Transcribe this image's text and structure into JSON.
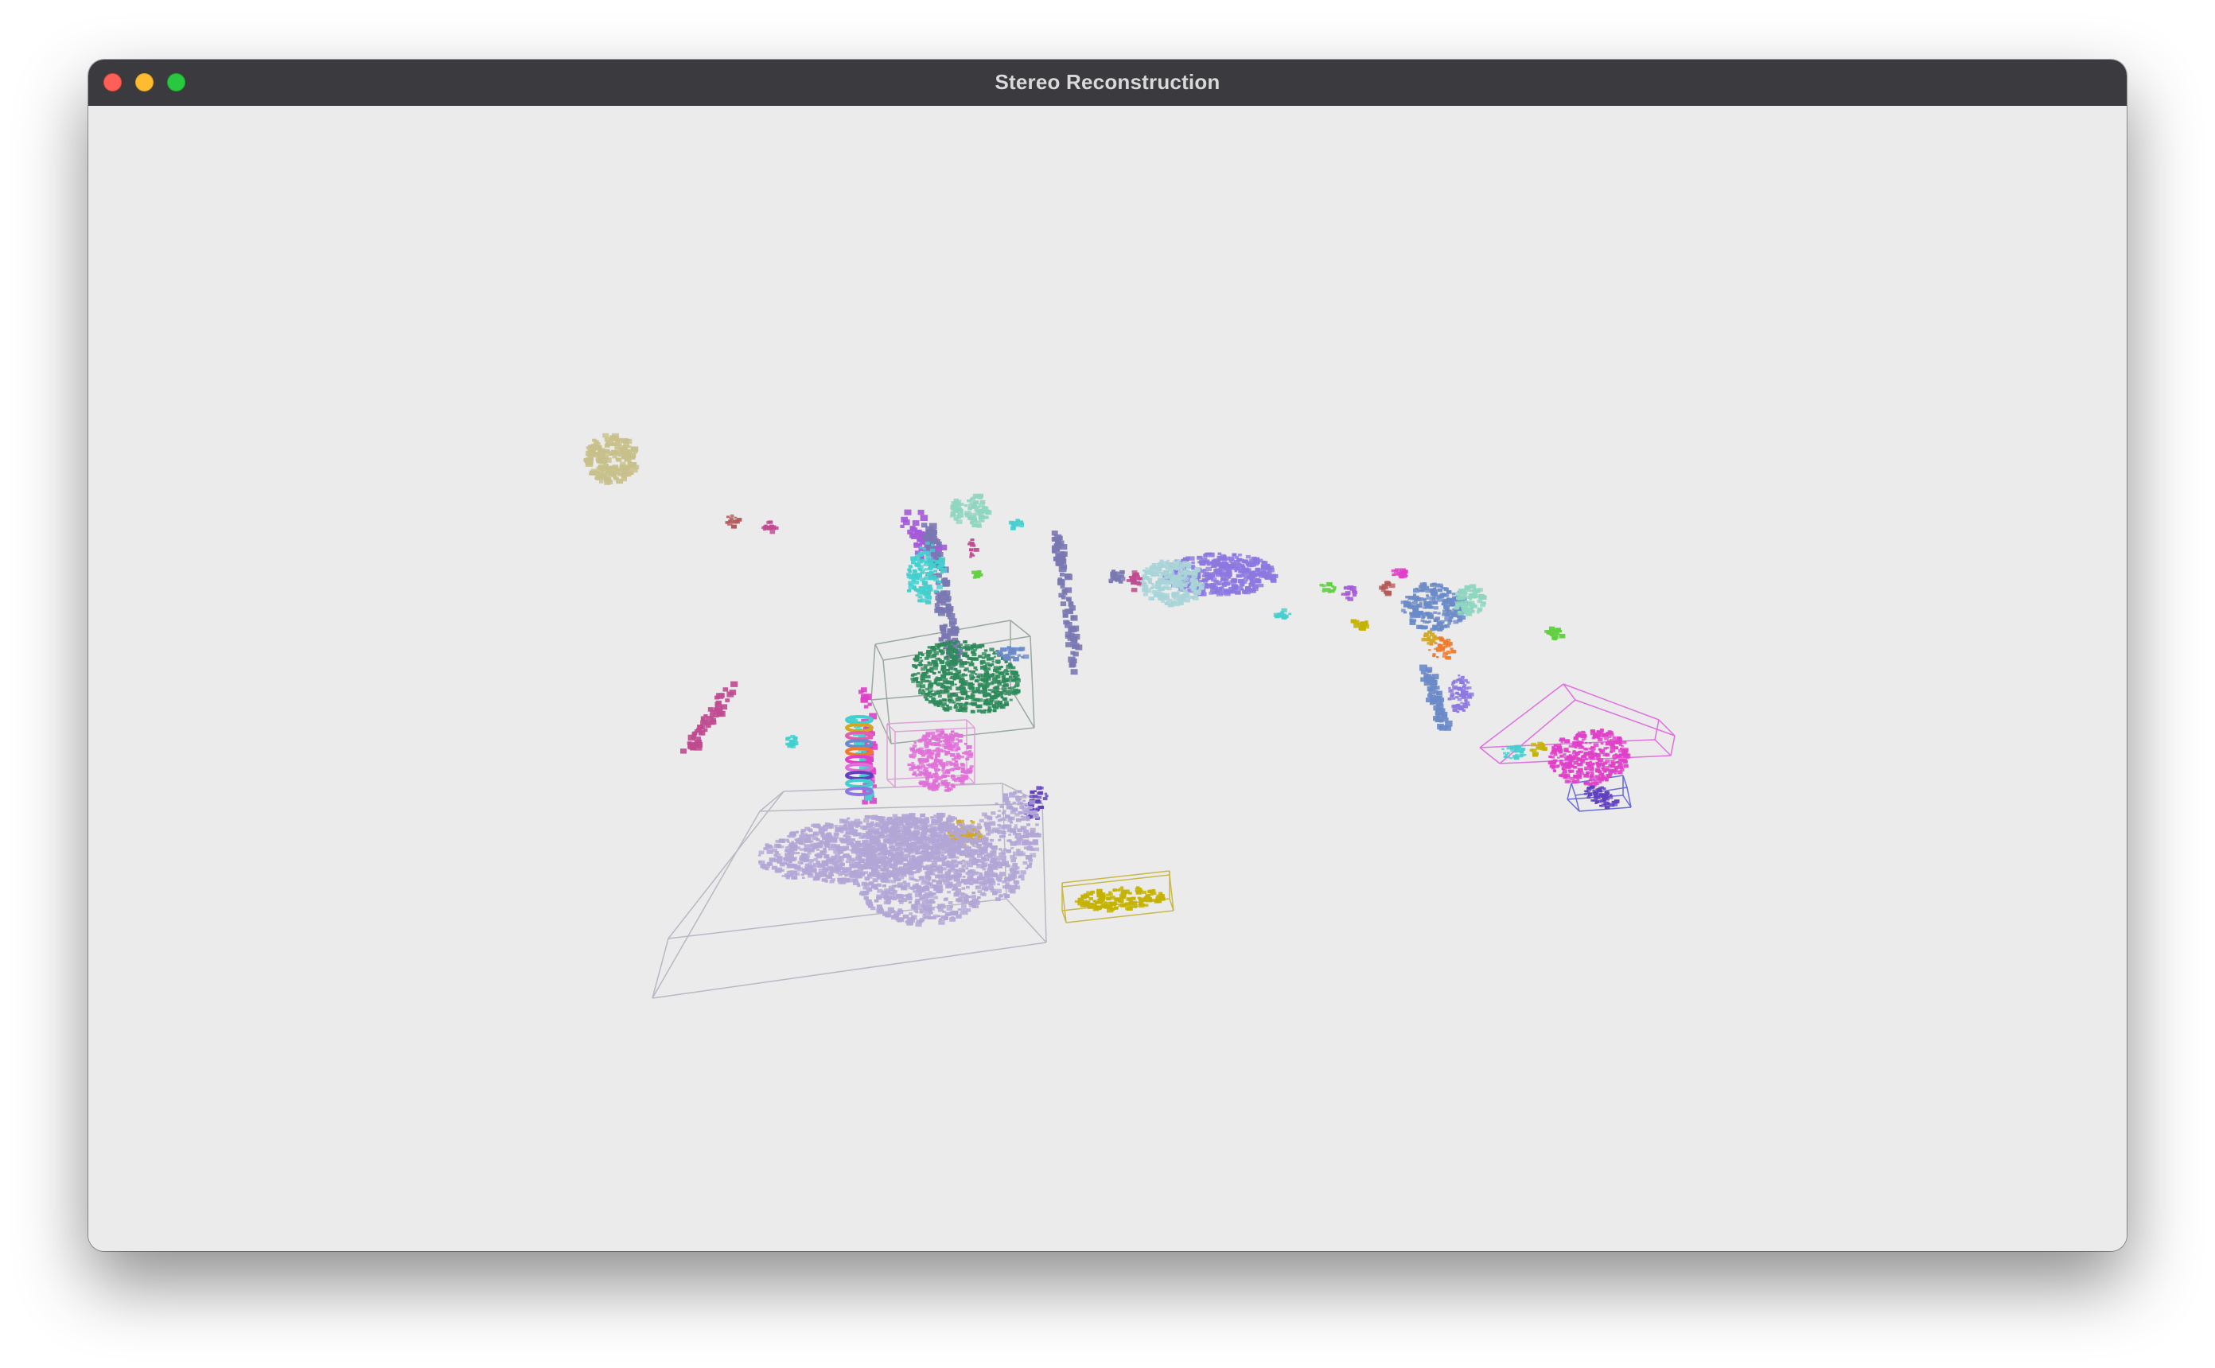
{
  "window": {
    "title": "Stereo Reconstruction",
    "controls": {
      "close_icon": "close-icon",
      "minimize_icon": "minimize-icon",
      "zoom_icon": "zoom-icon"
    }
  },
  "viewer": {
    "background": "#ebebeb",
    "clusters": [
      {
        "id": "c1",
        "color": "#c8c08a"
      },
      {
        "id": "c2",
        "color": "#b55a5a"
      },
      {
        "id": "c3",
        "color": "#c04a90"
      },
      {
        "id": "c4",
        "color": "#a45ad8"
      },
      {
        "id": "c5",
        "color": "#8fd6c0"
      },
      {
        "id": "c6",
        "color": "#44cfcf"
      },
      {
        "id": "c7",
        "color": "#7a78b2"
      },
      {
        "id": "c8",
        "color": "#2e8a5a"
      },
      {
        "id": "c9",
        "color": "#e070d8"
      },
      {
        "id": "c10",
        "color": "#b2a6d6"
      },
      {
        "id": "c11",
        "color": "#d2a820"
      },
      {
        "id": "c12",
        "color": "#c4b200"
      },
      {
        "id": "c13",
        "color": "#8c78e0"
      },
      {
        "id": "c14",
        "color": "#a8d4d8"
      },
      {
        "id": "c15",
        "color": "#e040c8"
      },
      {
        "id": "c16",
        "color": "#6a8ac8"
      },
      {
        "id": "c17",
        "color": "#6040c0"
      },
      {
        "id": "c18",
        "color": "#60d040"
      },
      {
        "id": "c19",
        "color": "#e060b0"
      },
      {
        "id": "c20",
        "color": "#f07a2a"
      }
    ]
  }
}
